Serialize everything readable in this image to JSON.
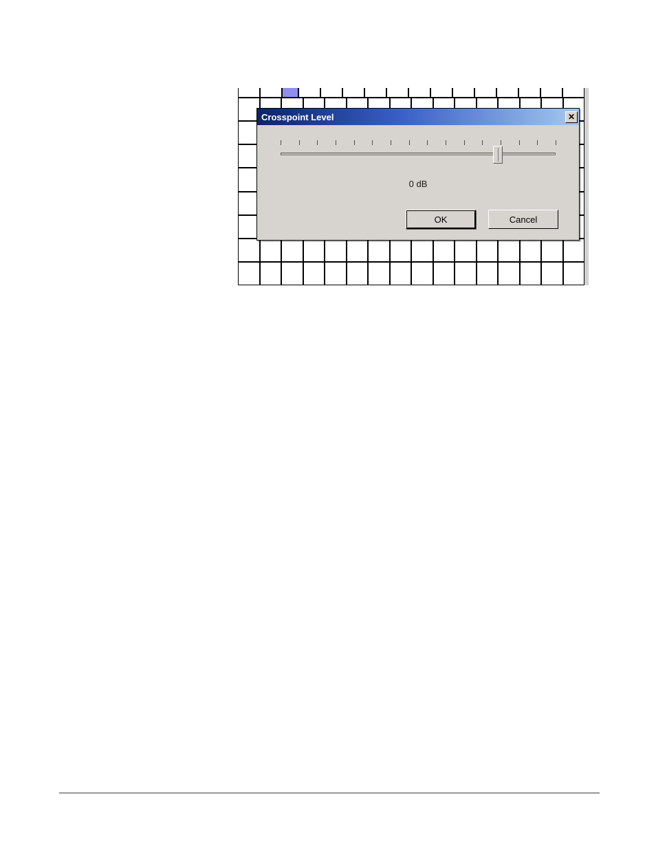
{
  "dialog": {
    "title": "Crosspoint Level",
    "value_label": "0 dB",
    "ok_label": "OK",
    "cancel_label": "Cancel",
    "close_glyph": "✕",
    "slider": {
      "tick_count": 16,
      "thumb_pct": 79
    }
  }
}
